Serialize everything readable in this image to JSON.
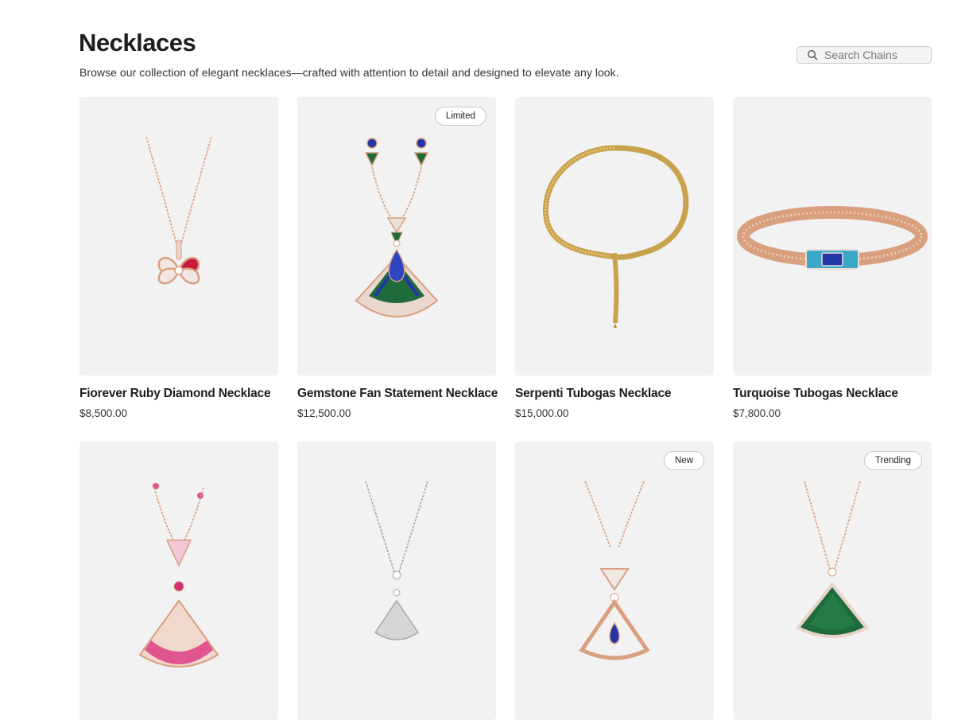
{
  "header": {
    "title": "Necklaces",
    "subtitle": "Browse our collection of elegant necklaces—crafted with attention to detail and designed to elevate any look."
  },
  "search": {
    "placeholder": "Search Chains",
    "value": ""
  },
  "products": [
    {
      "name": "Fiorever Ruby Diamond Necklace",
      "price": "$8,500.00",
      "badge": ""
    },
    {
      "name": "Gemstone Fan Statement Necklace",
      "price": "$12,500.00",
      "badge": "Limited"
    },
    {
      "name": "Serpenti Tubogas Necklace",
      "price": "$15,000.00",
      "badge": ""
    },
    {
      "name": "Turquoise Tubogas Necklace",
      "price": "$7,800.00",
      "badge": ""
    },
    {
      "name": "",
      "price": "",
      "badge": ""
    },
    {
      "name": "",
      "price": "",
      "badge": ""
    },
    {
      "name": "",
      "price": "",
      "badge": "New"
    },
    {
      "name": "",
      "price": "",
      "badge": "Trending"
    }
  ],
  "colors": {
    "card_background": "#f2f2f2",
    "rose_gold": "#d9a07f",
    "gold": "#c9a24e",
    "silver": "#a8a8a8",
    "ruby": "#c8193e",
    "sapphire": "#2336a8",
    "malachite": "#1f6b3c",
    "turquoise": "#3ba7c9",
    "pink_sapphire": "#e0558f"
  }
}
